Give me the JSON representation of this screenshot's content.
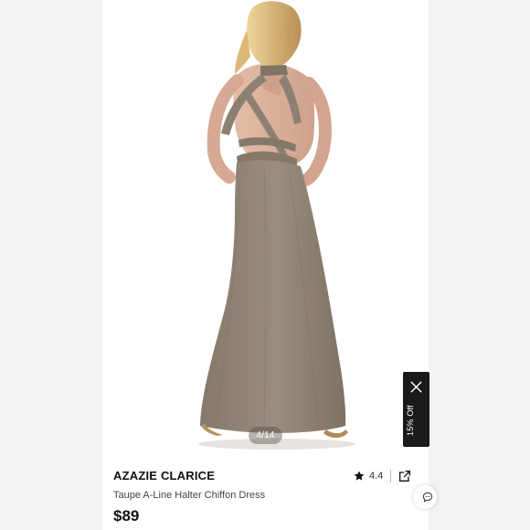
{
  "product": {
    "image_counter": "4/14",
    "brand": "AZAZIE CLARICE",
    "name": "Taupe A-Line Halter Chiffon Dress",
    "price": "$89",
    "rating": "4.4"
  },
  "promo": {
    "label": "15% Off"
  },
  "icons": {
    "star": "star-icon",
    "share": "share-icon",
    "close": "close-icon",
    "chat": "chat-icon"
  },
  "colors": {
    "dress": "#8f8274",
    "background": "#f3f2f2",
    "promo_tab": "#1a1a1a"
  }
}
